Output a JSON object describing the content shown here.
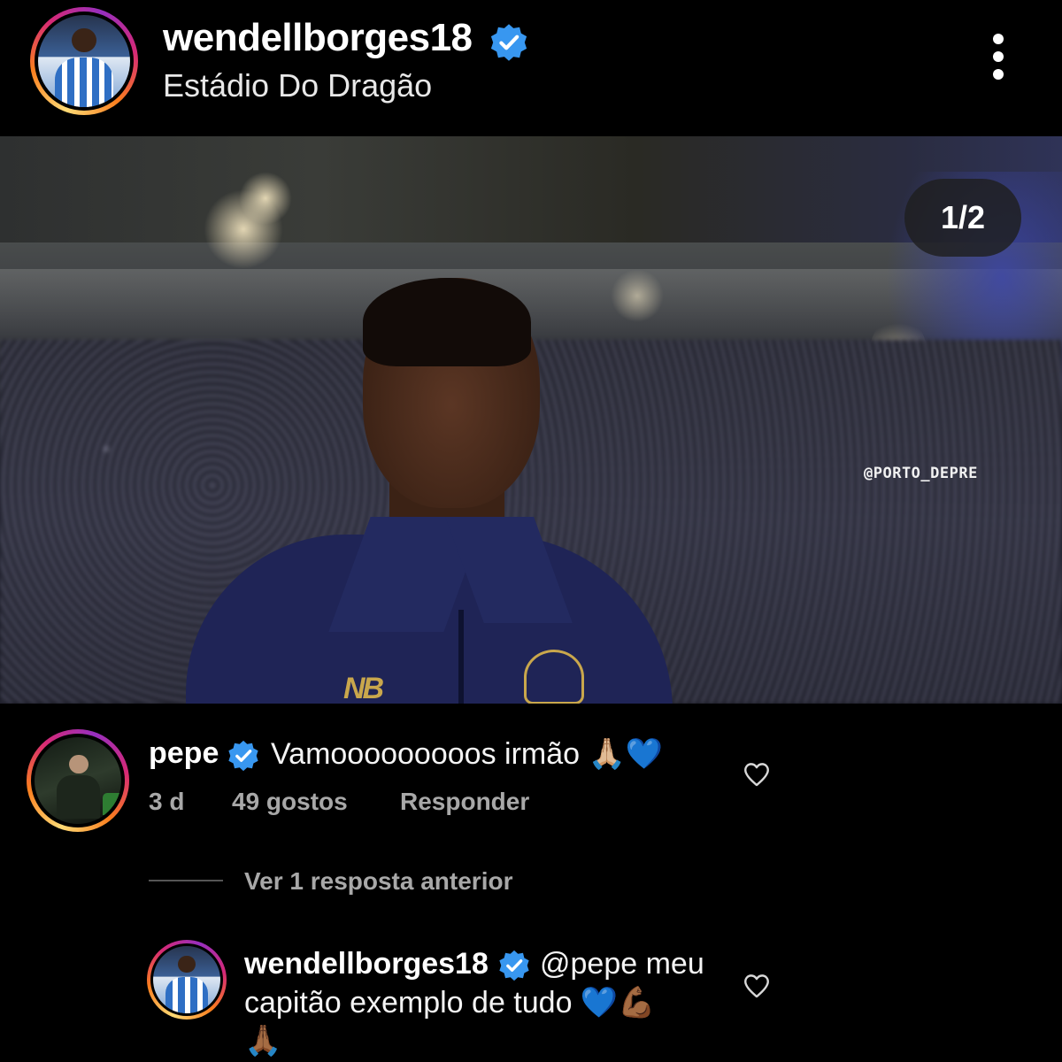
{
  "header": {
    "username": "wendellborges18",
    "location": "Estádio Do Dragão",
    "verified_icon": "verified-badge-icon",
    "more_icon": "more-vertical-icon"
  },
  "post": {
    "page_counter": "1/2",
    "watermark": "@PORTO_DEPRE",
    "kit_logo": "NB"
  },
  "comments": [
    {
      "username": "pepe",
      "text": "Vamooooooooos irmão 🙏🏼💙",
      "time": "3 d",
      "likes": "49 gostos",
      "reply_label": "Responder",
      "like_icon": "heart-outline-icon"
    }
  ],
  "replies_toggle": "Ver 1 resposta anterior",
  "reply": {
    "username": "wendellborges18",
    "text_line1": "@pepe meu",
    "text_line2": "capitão exemplo de tudo 💙💪🏾",
    "text_line3": "🙏🏾",
    "like_icon": "heart-outline-icon"
  },
  "colors": {
    "background": "#000000",
    "verified_blue": "#3897f0",
    "secondary_text": "#a8a8a8"
  }
}
